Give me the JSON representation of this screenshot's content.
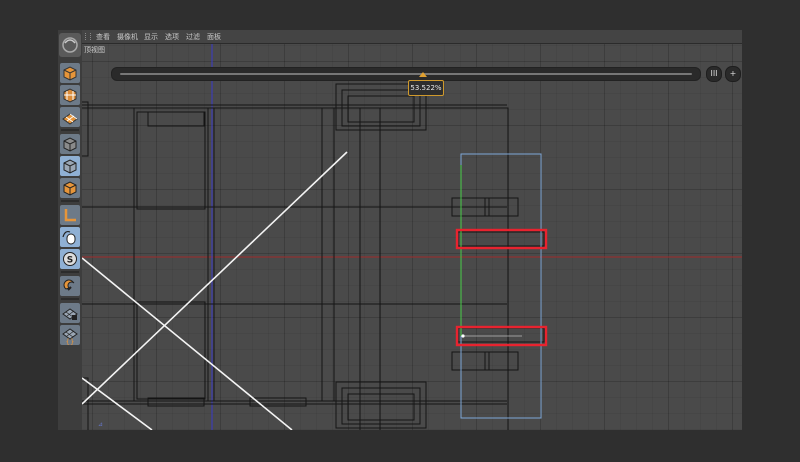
{
  "menubar": {
    "items": [
      "查看",
      "摄像机",
      "显示",
      "选项",
      "过滤",
      "面板"
    ]
  },
  "viewport": {
    "label": "顶视图",
    "zoom_readout": "53.522%",
    "timeline_progress": 0.535,
    "grid_button_label": "III",
    "add_button_label": "+"
  },
  "toolbar": {
    "icons": [
      "app-logo-icon",
      "cube-icon",
      "checker-cube-icon",
      "checker-plane-icon",
      "model-mode-icon",
      "object-mode-icon",
      "texture-mode-icon",
      "axis-corner-icon",
      "mouse-move-icon",
      "snap-s-icon",
      "magnet-icon",
      "grid-lock-icon",
      "grid-brace-icon"
    ]
  },
  "colors": {
    "highlight": "#e8232f",
    "selection": "#7fa8d8",
    "zoom_border": "#d09a2c",
    "axis_x": "#a02a2a",
    "axis_y": "#3a3ac8"
  }
}
